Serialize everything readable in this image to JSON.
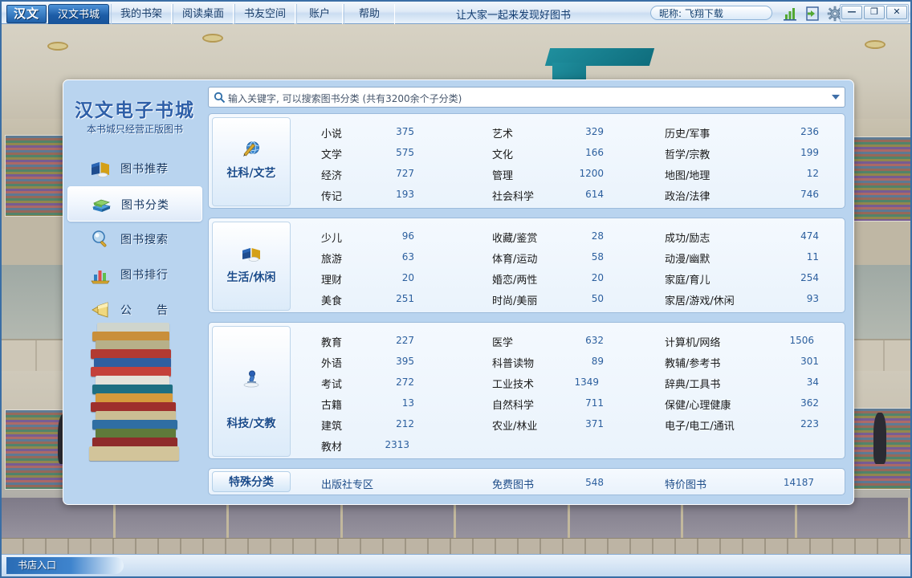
{
  "titlebar": {
    "logo": "汉文",
    "tabs": [
      {
        "label": "汉文书城",
        "active": true
      },
      {
        "label": "我的书架",
        "active": false
      },
      {
        "label": "阅读桌面",
        "active": false
      },
      {
        "label": "书友空间",
        "active": false
      },
      {
        "label": "账户",
        "active": false
      },
      {
        "label": "帮助",
        "active": false
      }
    ],
    "slogan": "让大家一起来发现好图书",
    "nickname": "昵称: 飞翔下载",
    "icons": [
      "chart-icon",
      "login-icon",
      "gear-icon"
    ],
    "window_controls": [
      {
        "name": "minimize",
        "glyph": "—"
      },
      {
        "name": "maximize",
        "glyph": "❐"
      },
      {
        "name": "close",
        "glyph": "✕"
      }
    ]
  },
  "sidebar": {
    "title": "汉文电子书城",
    "subtitle": "本书城只经营正版图书",
    "items": [
      {
        "label": "图书推荐",
        "icon": "open-book-icon",
        "active": false
      },
      {
        "label": "图书分类",
        "icon": "books-stack-icon",
        "active": true
      },
      {
        "label": "图书搜索",
        "icon": "magnifier-icon",
        "active": false
      },
      {
        "label": "图书排行",
        "icon": "bar-chart-icon",
        "active": false
      },
      {
        "label": "公　　告",
        "icon": "megaphone-icon",
        "active": false
      }
    ]
  },
  "search": {
    "icon": "search-icon",
    "placeholder": "输入关键字, 可以搜索图书分类 (共有3200余个子分类)",
    "dropdown_icon": "chevron-down-icon"
  },
  "groups": [
    {
      "label": "社科/文艺",
      "icon": "globe-pen-icon",
      "columns": [
        [
          {
            "name": "小说",
            "count": "375"
          },
          {
            "name": "文学",
            "count": "575"
          },
          {
            "name": "经济",
            "count": "727"
          },
          {
            "name": "传记",
            "count": "193"
          }
        ],
        [
          {
            "name": "艺术",
            "count": "329"
          },
          {
            "name": "文化",
            "count": "166"
          },
          {
            "name": "管理",
            "count": "1200"
          },
          {
            "name": "社会科学",
            "count": "614"
          }
        ],
        [
          {
            "name": "历史/军事",
            "count": "236"
          },
          {
            "name": "哲学/宗教",
            "count": "199"
          },
          {
            "name": "地图/地理",
            "count": "12"
          },
          {
            "name": "政治/法律",
            "count": "746"
          }
        ]
      ]
    },
    {
      "label": "生活/休闲",
      "icon": "open-book-icon",
      "columns": [
        [
          {
            "name": "少儿",
            "count": "96"
          },
          {
            "name": "旅游",
            "count": "63"
          },
          {
            "name": "理财",
            "count": "20"
          },
          {
            "name": "美食",
            "count": "251"
          }
        ],
        [
          {
            "name": "收藏/鉴赏",
            "count": "28"
          },
          {
            "name": "体育/运动",
            "count": "58"
          },
          {
            "name": "婚恋/两性",
            "count": "20"
          },
          {
            "name": "时尚/美丽",
            "count": "50"
          }
        ],
        [
          {
            "name": "成功/励志",
            "count": "474"
          },
          {
            "name": "动漫/幽默",
            "count": "11"
          },
          {
            "name": "家庭/育儿",
            "count": "254"
          },
          {
            "name": "家居/游戏/休闲",
            "count": "93"
          }
        ]
      ]
    },
    {
      "label": "科技/文教",
      "icon": "microscope-icon",
      "columns": [
        [
          {
            "name": "教育",
            "count": "227"
          },
          {
            "name": "外语",
            "count": "395"
          },
          {
            "name": "考试",
            "count": "272"
          },
          {
            "name": "古籍",
            "count": "13"
          },
          {
            "name": "建筑",
            "count": "212"
          },
          {
            "name": "教材",
            "count": "2313"
          }
        ],
        [
          {
            "name": "医学",
            "count": "632"
          },
          {
            "name": "科普读物",
            "count": "89"
          },
          {
            "name": "工业技术",
            "count": "1349"
          },
          {
            "name": "自然科学",
            "count": "711"
          },
          {
            "name": "农业/林业",
            "count": "371"
          }
        ],
        [
          {
            "name": "计算机/网络",
            "count": "1506"
          },
          {
            "name": "教辅/参考书",
            "count": "301"
          },
          {
            "name": "辞典/工具书",
            "count": "34"
          },
          {
            "name": "保健/心理健康",
            "count": "362"
          },
          {
            "name": "电子/电工/通讯",
            "count": "223"
          }
        ]
      ]
    }
  ],
  "special": {
    "label": "特殊分类",
    "items": [
      {
        "name": "出版社专区",
        "count": ""
      },
      {
        "name": "免费图书",
        "count": "548"
      },
      {
        "name": "特价图书",
        "count": "14187"
      }
    ]
  },
  "taskbar": {
    "item": "书店入口"
  },
  "colors": {
    "accent": "#1c5ca6",
    "panel": "#b9d4ef",
    "count_text": "#2c5f9e",
    "group_border": "#9cbbdb"
  }
}
